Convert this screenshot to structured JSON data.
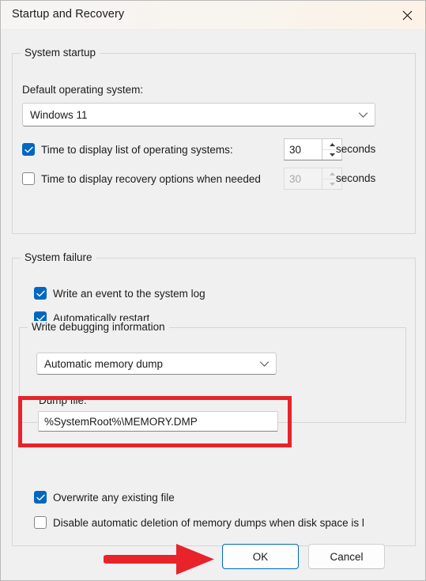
{
  "window": {
    "title": "Startup and Recovery",
    "close_icon": "close-icon"
  },
  "system_startup": {
    "legend": "System startup",
    "default_os_label": "Default operating system:",
    "default_os_value": "Windows 11",
    "default_os_chevron": "chevron-down-icon",
    "time_list": {
      "label": "Time to display list of operating systems:",
      "checked": true,
      "value": "30",
      "units": "seconds"
    },
    "time_recovery": {
      "label": "Time to display recovery options when needed",
      "checked": false,
      "value": "30",
      "units": "seconds"
    }
  },
  "system_failure": {
    "legend": "System failure",
    "write_event": {
      "label": "Write an event to the system log",
      "checked": true
    },
    "auto_restart": {
      "label": "Automatically restart",
      "checked": true
    },
    "debug": {
      "legend": "Write debugging information",
      "dump_type_value": "Automatic memory dump",
      "dump_type_chevron": "chevron-down-icon",
      "dump_file_label": "Dump file:",
      "dump_file_value": "%SystemRoot%\\MEMORY.DMP"
    },
    "overwrite": {
      "label": "Overwrite any existing file",
      "checked": true
    },
    "disable_deletion": {
      "label": "Disable automatic deletion of memory dumps when disk space is l",
      "checked": false
    }
  },
  "footer": {
    "ok_label": "OK",
    "cancel_label": "Cancel"
  },
  "annotations": {
    "highlight_color": "#e8232a",
    "arrow_color": "#e8232a"
  }
}
